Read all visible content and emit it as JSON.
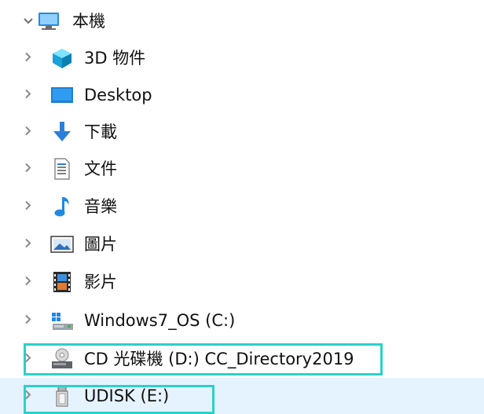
{
  "tree": {
    "root": {
      "label": "本機",
      "icon": "computer-icon",
      "expanded": true
    },
    "items": [
      {
        "label": "3D 物件",
        "icon": "3d-objects-icon"
      },
      {
        "label": "Desktop",
        "icon": "desktop-icon"
      },
      {
        "label": "下載",
        "icon": "download-arrow-icon"
      },
      {
        "label": "文件",
        "icon": "document-icon"
      },
      {
        "label": "音樂",
        "icon": "music-note-icon"
      },
      {
        "label": "圖片",
        "icon": "pictures-icon"
      },
      {
        "label": "影片",
        "icon": "film-icon"
      },
      {
        "label": "Windows7_OS (C:)",
        "icon": "windows-drive-icon"
      },
      {
        "label": "CD 光碟機 (D:) CC_Directory2019",
        "icon": "cd-drive-icon",
        "highlighted": true
      },
      {
        "label": "UDISK (E:)",
        "icon": "usb-drive-icon",
        "highlighted": true,
        "selected": true
      }
    ]
  },
  "colors": {
    "highlight_border": "#2ad1c9",
    "selected_row": "#e5f3ff",
    "chevron": "#7a7a7a",
    "text": "#111111"
  }
}
